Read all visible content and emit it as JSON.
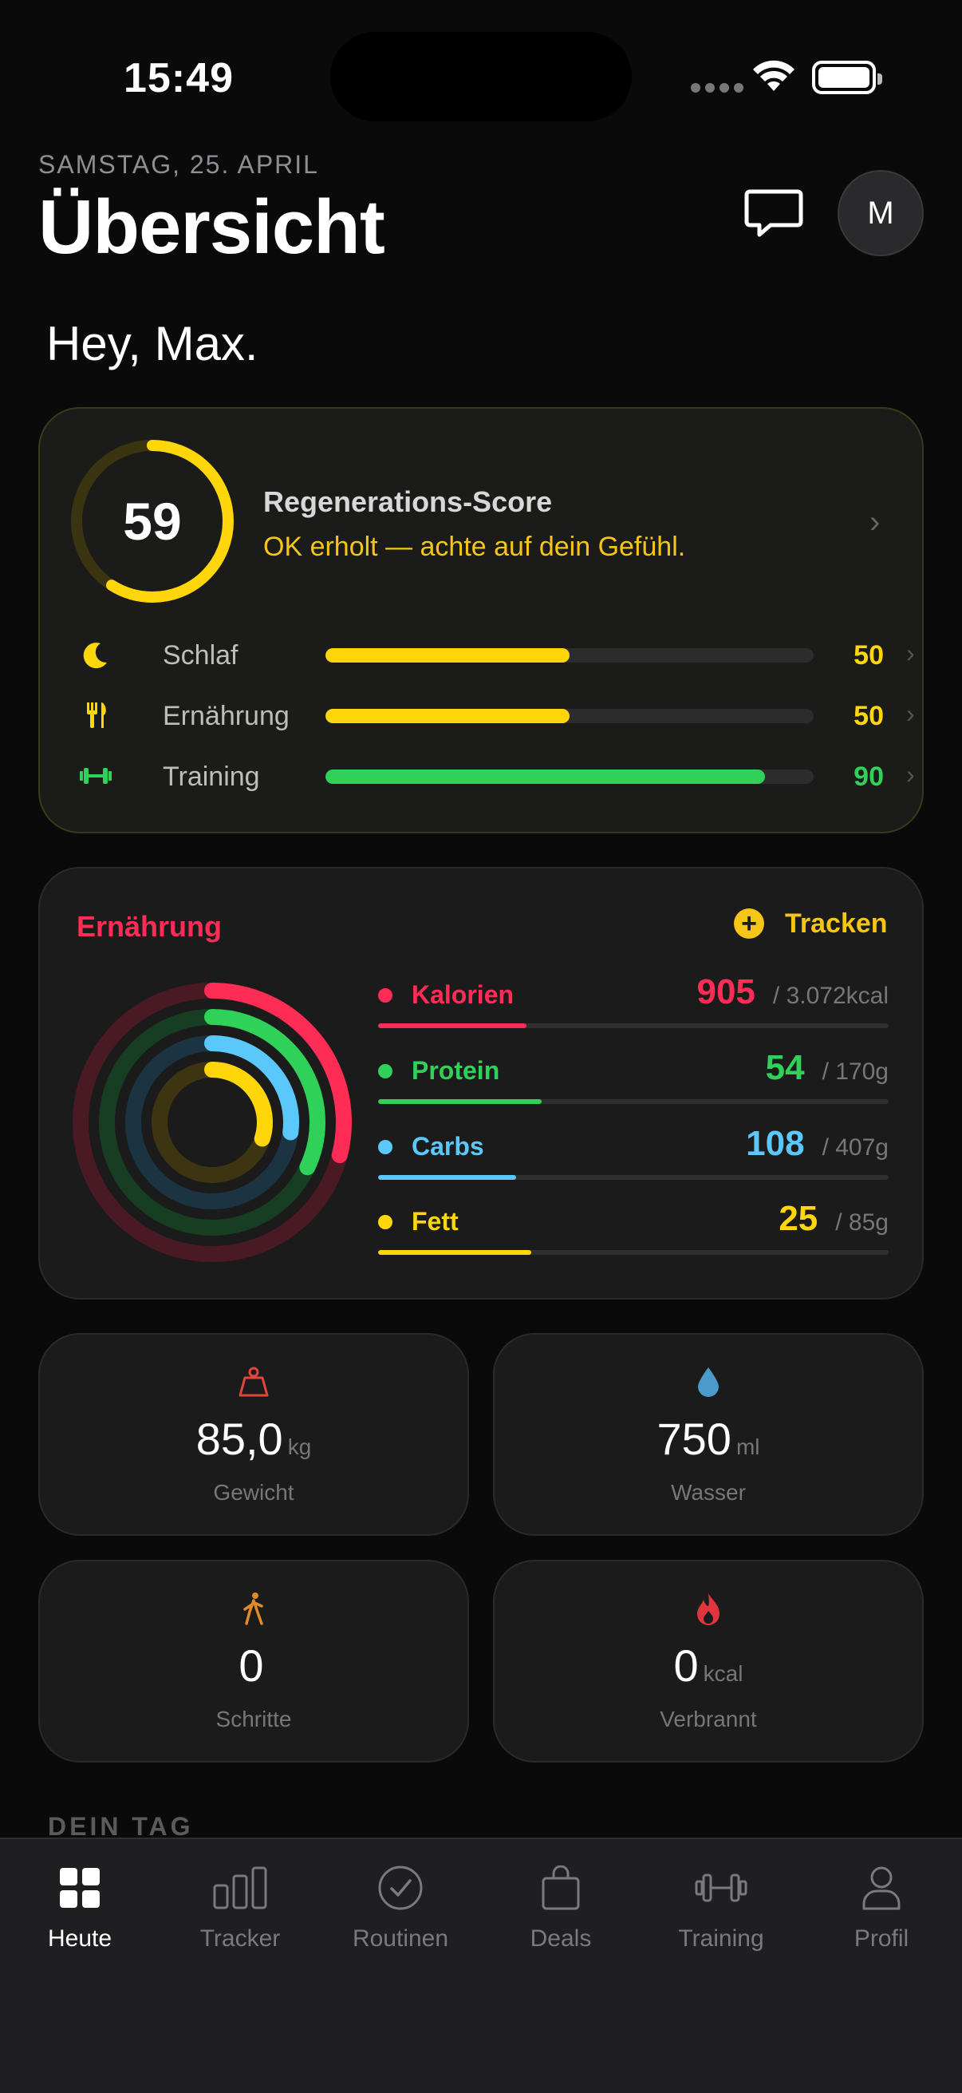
{
  "status_bar": {
    "time": "15:49"
  },
  "header": {
    "date": "SAMSTAG, 25. APRIL",
    "title": "Übersicht",
    "avatar_initial": "M",
    "greeting": "Hey, Max."
  },
  "regeneration": {
    "score": "59",
    "score_fraction": 0.59,
    "title": "Regenerations-Score",
    "subtitle": "OK erholt — achte auf dein Gefühl.",
    "metrics": [
      {
        "label": "Schlaf",
        "value": "50",
        "fraction": 0.5,
        "color": "#ffd60a",
        "icon": "moon-icon"
      },
      {
        "label": "Ernährung",
        "value": "50",
        "fraction": 0.5,
        "color": "#ffd60a",
        "icon": "fork-knife-icon"
      },
      {
        "label": "Training",
        "value": "90",
        "fraction": 0.9,
        "color": "#30d158",
        "icon": "dumbbell-icon"
      }
    ]
  },
  "nutrition": {
    "title": "Ernährung",
    "track_label": "Tracken",
    "macros": [
      {
        "name": "Kalorien",
        "value": "905",
        "goal": "/ 3.072kcal",
        "fraction": 0.29,
        "color": "#ff2d55"
      },
      {
        "name": "Protein",
        "value": "54",
        "goal": "/ 170g",
        "fraction": 0.32,
        "color": "#30d158"
      },
      {
        "name": "Carbs",
        "value": "108",
        "goal": "/ 407g",
        "fraction": 0.27,
        "color": "#5ac8fa"
      },
      {
        "name": "Fett",
        "value": "25",
        "goal": "/ 85g",
        "fraction": 0.3,
        "color": "#ffd60a"
      }
    ]
  },
  "tiles": [
    {
      "value": "85,0",
      "unit": "kg",
      "label": "Gewicht",
      "icon": "scale-weight-icon",
      "color": "#e0463a"
    },
    {
      "value": "750",
      "unit": "ml",
      "label": "Wasser",
      "icon": "water-drop-icon",
      "color": "#4a9bc9"
    },
    {
      "value": "0",
      "unit": "",
      "label": "Schritte",
      "icon": "walking-icon",
      "color": "#e08a2a"
    },
    {
      "value": "0",
      "unit": "kcal",
      "label": "Verbrannt",
      "icon": "flame-icon",
      "color": "#e0353f"
    }
  ],
  "section": {
    "label": "DEIN TAG"
  },
  "tabbar": {
    "tabs": [
      {
        "label": "Heute",
        "icon": "grid-icon",
        "active": true
      },
      {
        "label": "Tracker",
        "icon": "bar-chart-icon",
        "active": false
      },
      {
        "label": "Routinen",
        "icon": "checkmark-circle-icon",
        "active": false
      },
      {
        "label": "Deals",
        "icon": "shopping-bag-icon",
        "active": false
      },
      {
        "label": "Training",
        "icon": "dumbbell-icon",
        "active": false
      },
      {
        "label": "Profil",
        "icon": "person-icon",
        "active": false
      }
    ]
  }
}
